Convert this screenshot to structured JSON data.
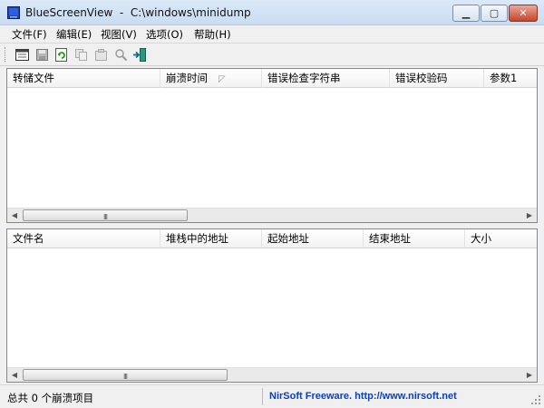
{
  "window": {
    "title": "BlueScreenView  -  C:\\windows\\minidump",
    "icon": "bluescreen-app-icon",
    "controls": {
      "minimize": "minimize-icon",
      "maximize": "maximize-icon",
      "close": "close-icon"
    }
  },
  "menu": {
    "items": [
      {
        "label": "文件(F)"
      },
      {
        "label": "编辑(E)"
      },
      {
        "label": "视图(V)"
      },
      {
        "label": "选项(O)"
      },
      {
        "label": "帮助(H)"
      }
    ]
  },
  "toolbar": {
    "buttons": [
      {
        "icon": "html-report-icon"
      },
      {
        "icon": "save-icon"
      },
      {
        "icon": "refresh-icon"
      },
      {
        "icon": "copy-icon"
      },
      {
        "icon": "properties-icon"
      },
      {
        "icon": "find-icon"
      },
      {
        "icon": "exit-icon"
      }
    ]
  },
  "top_list": {
    "columns": [
      {
        "label": "转储文件"
      },
      {
        "label": "崩溃时间"
      },
      {
        "label": "错误检查字符串"
      },
      {
        "label": "错误校验码"
      },
      {
        "label": "参数1"
      }
    ],
    "rows": [],
    "scroll_grip": "III"
  },
  "bottom_list": {
    "columns": [
      {
        "label": "文件名"
      },
      {
        "label": "堆栈中的地址"
      },
      {
        "label": "起始地址"
      },
      {
        "label": "结束地址"
      },
      {
        "label": "大小"
      }
    ],
    "rows": [],
    "scroll_grip": "III"
  },
  "status": {
    "left": "总共 0 个崩溃项目",
    "right": "NirSoft Freeware.  http://www.nirsoft.net"
  },
  "colors": {
    "link": "#0b3fc0",
    "close_button": "#c8442a",
    "titlebar": "#dce9f7"
  }
}
